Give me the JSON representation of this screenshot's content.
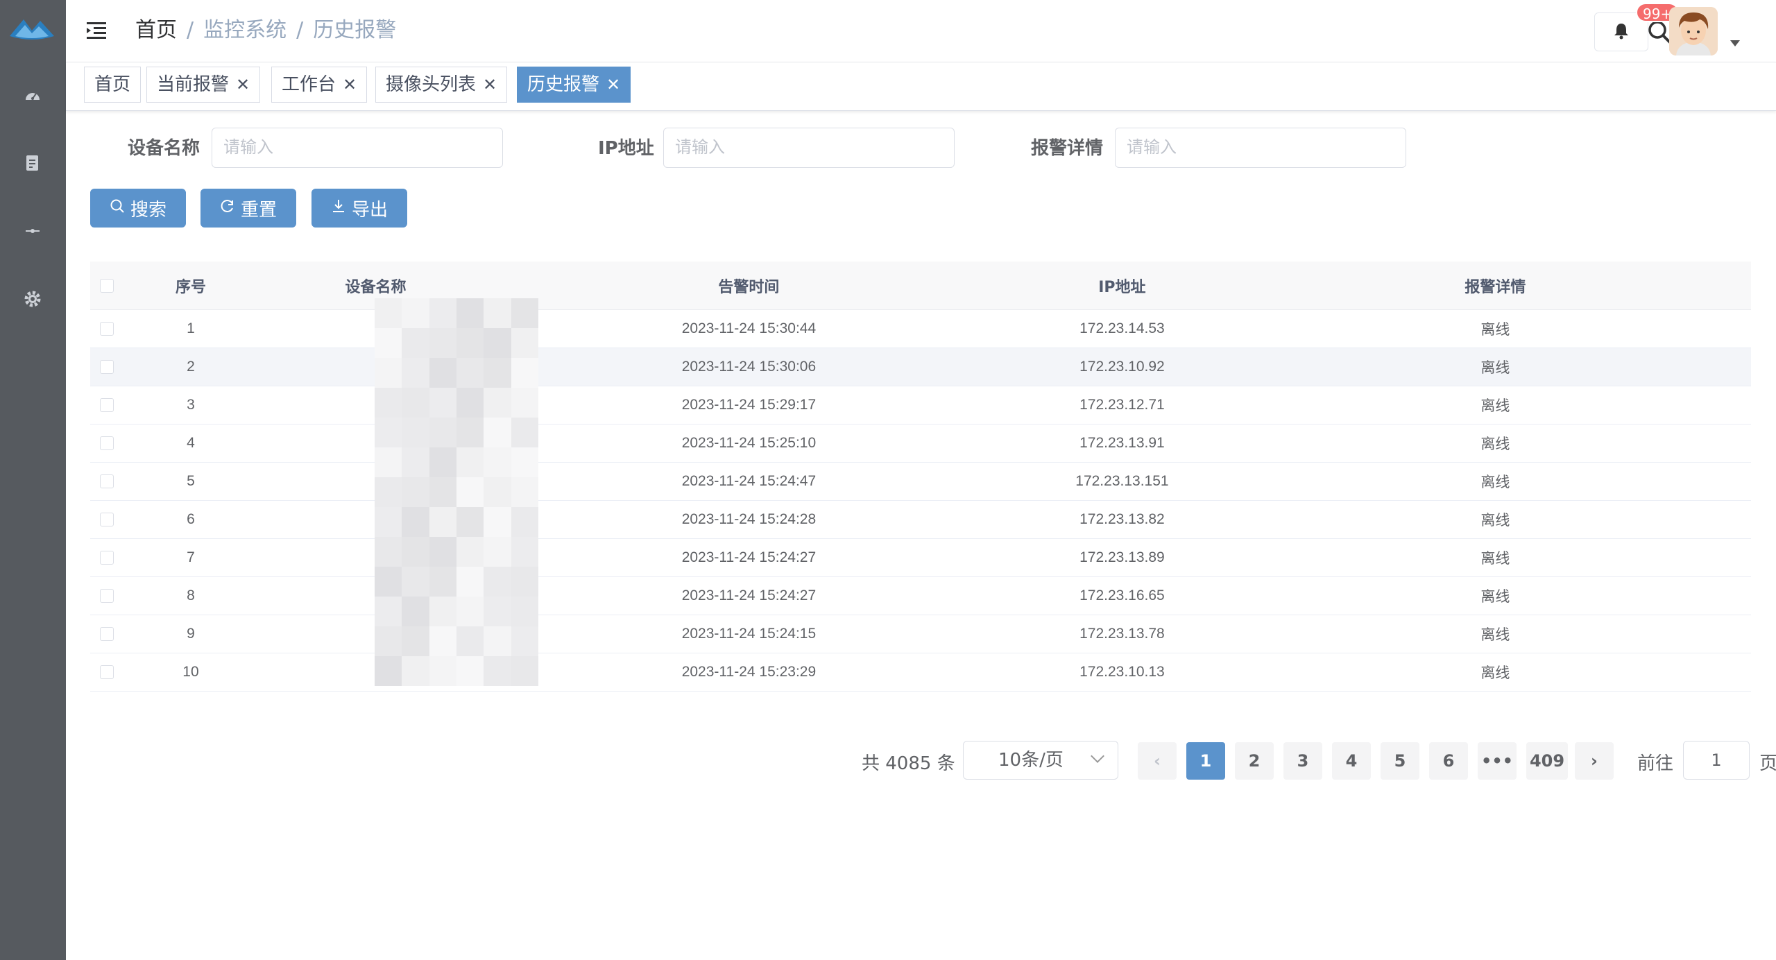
{
  "header": {
    "breadcrumb": [
      "首页",
      "监控系统",
      "历史报警"
    ],
    "separator": "/",
    "notification_badge": "99+"
  },
  "tags": [
    {
      "label": "首页",
      "closable": false,
      "active": false
    },
    {
      "label": "当前报警",
      "closable": true,
      "active": false
    },
    {
      "label": "工作台",
      "closable": true,
      "active": false
    },
    {
      "label": "摄像头列表",
      "closable": true,
      "active": false
    },
    {
      "label": "历史报警",
      "closable": true,
      "active": true
    }
  ],
  "filters": {
    "device_name": {
      "label": "设备名称",
      "placeholder": "请输入"
    },
    "ip": {
      "label": "IP地址",
      "placeholder": "请输入"
    },
    "detail": {
      "label": "报警详情",
      "placeholder": "请输入"
    }
  },
  "buttons": {
    "search": "搜索",
    "reset": "重置",
    "export": "导出"
  },
  "table": {
    "columns": [
      "序号",
      "设备名称",
      "告警时间",
      "IP地址",
      "报警详情"
    ],
    "rows": [
      {
        "index": "1",
        "name": "",
        "time": "2023-11-24 15:30:44",
        "ip": "172.23.14.53",
        "detail": "离线"
      },
      {
        "index": "2",
        "name": "门",
        "time": "2023-11-24 15:30:06",
        "ip": "172.23.10.92",
        "detail": "离线"
      },
      {
        "index": "3",
        "name": "",
        "time": "2023-11-24 15:29:17",
        "ip": "172.23.12.71",
        "detail": "离线"
      },
      {
        "index": "4",
        "name": "门",
        "time": "2023-11-24 15:25:10",
        "ip": "172.23.13.91",
        "detail": "离线"
      },
      {
        "index": "5",
        "name": "",
        "time": "2023-11-24 15:24:47",
        "ip": "172.23.13.151",
        "detail": "离线"
      },
      {
        "index": "6",
        "name": "",
        "time": "2023-11-24 15:24:28",
        "ip": "172.23.13.82",
        "detail": "离线"
      },
      {
        "index": "7",
        "name": "门访",
        "time": "2023-11-24 15:24:27",
        "ip": "172.23.13.89",
        "detail": "离线"
      },
      {
        "index": "8",
        "name": "",
        "time": "2023-11-24 15:24:27",
        "ip": "172.23.16.65",
        "detail": "离线"
      },
      {
        "index": "9",
        "name": "",
        "time": "2023-11-24 15:24:15",
        "ip": "172.23.13.78",
        "detail": "离线"
      },
      {
        "index": "10",
        "name": "门访",
        "time": "2023-11-24 15:23:29",
        "ip": "172.23.10.13",
        "detail": "离线"
      }
    ]
  },
  "pagination": {
    "total": "共 4085 条",
    "page_size": "10条/页",
    "pages": [
      "1",
      "2",
      "3",
      "4",
      "5",
      "6"
    ],
    "ellipsis": "•••",
    "last_page": "409",
    "current": "1",
    "goto_prefix": "前往",
    "goto_value": "1",
    "goto_suffix": "页"
  },
  "colors": {
    "sidebar": "#565a5f",
    "primary": "#5b93cc",
    "badge": "#f56c6c"
  },
  "icons": [
    "logo",
    "dashboard-icon",
    "document-icon",
    "link-icon",
    "settings-icon",
    "hamburger-icon",
    "search-icon",
    "bell-icon",
    "avatar"
  ]
}
